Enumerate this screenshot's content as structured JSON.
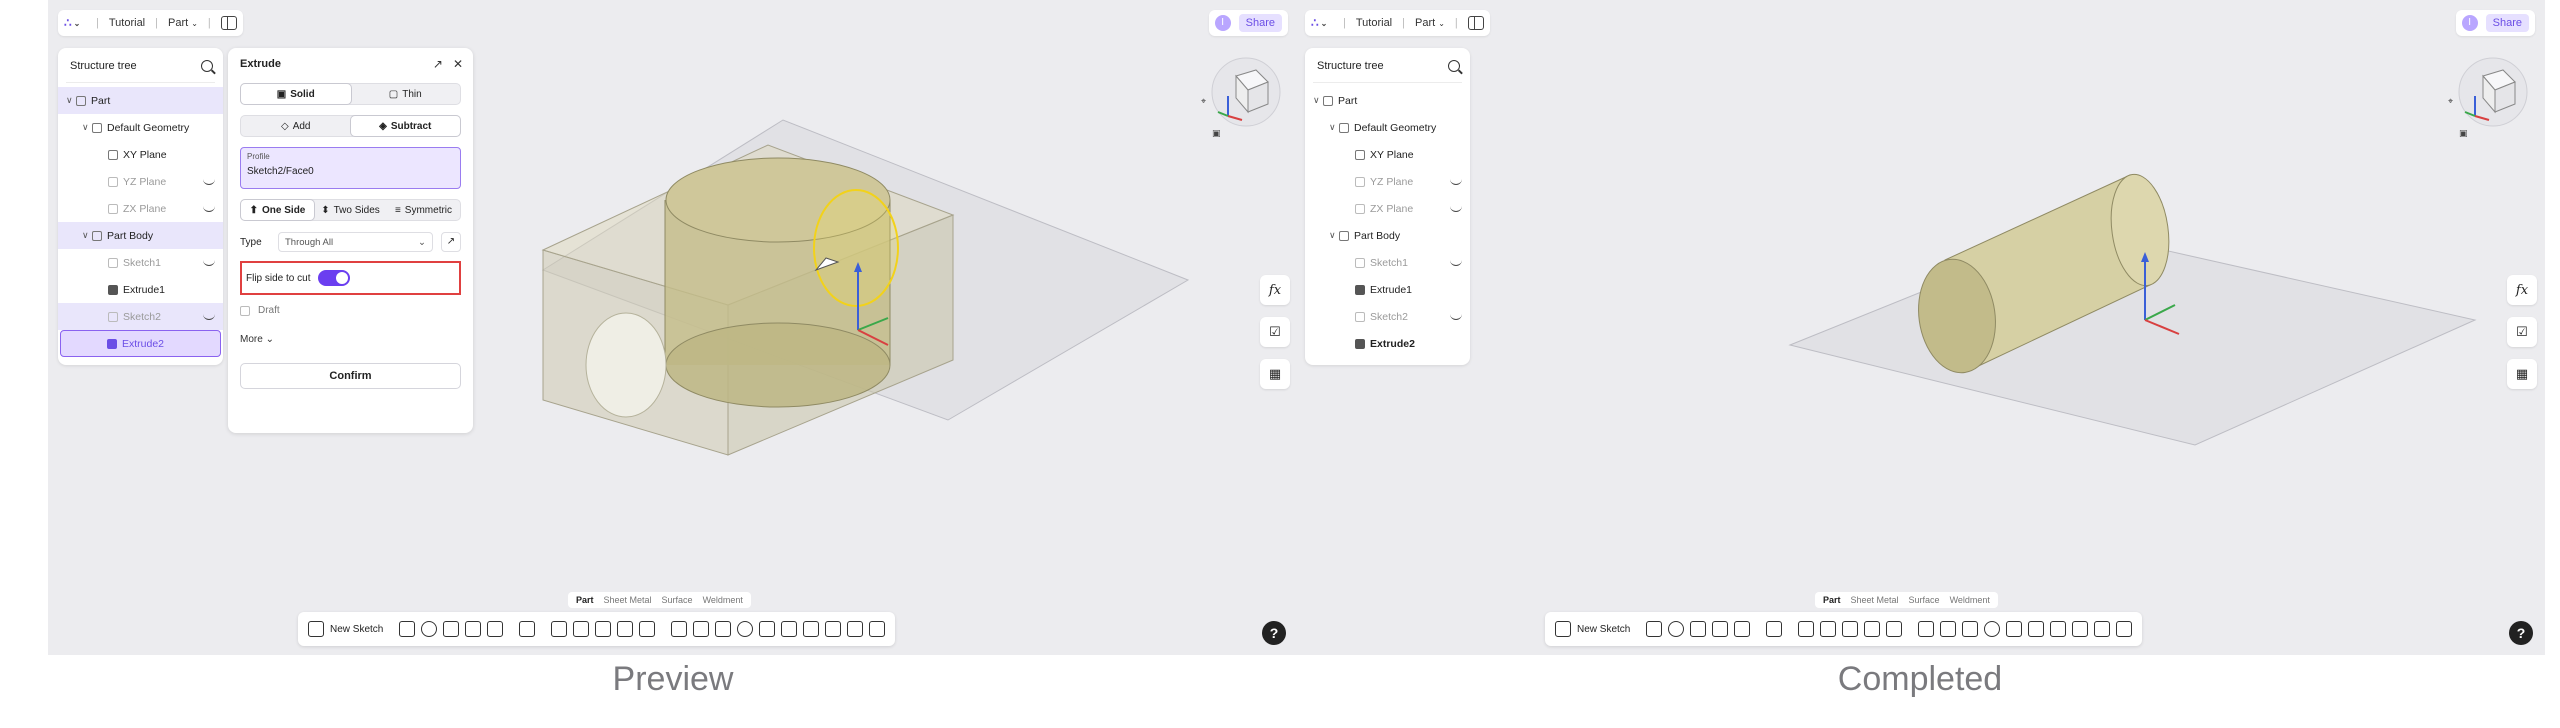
{
  "captions": {
    "left": "Preview",
    "right": "Completed"
  },
  "topbar": {
    "breadcrumb": "Tutorial",
    "doc_type": "Part",
    "share": "Share",
    "avatar_initial": "I"
  },
  "tree": {
    "title": "Structure tree",
    "items": [
      {
        "label": "Part"
      },
      {
        "label": "Default Geometry"
      },
      {
        "label": "XY Plane"
      },
      {
        "label": "YZ Plane"
      },
      {
        "label": "ZX Plane"
      },
      {
        "label": "Part Body"
      },
      {
        "label": "Sketch1"
      },
      {
        "label": "Extrude1"
      },
      {
        "label": "Sketch2"
      },
      {
        "label": "Extrude2"
      }
    ]
  },
  "extrude": {
    "title": "Extrude",
    "mode_solid": "Solid",
    "mode_thin": "Thin",
    "op_add": "Add",
    "op_subtract": "Subtract",
    "profile_label": "Profile",
    "profile_value": "Sketch2/Face0",
    "side_one": "One Side",
    "side_two": "Two Sides",
    "side_sym": "Symmetric",
    "type_label": "Type",
    "type_value": "Through All",
    "flip_label": "Flip side to cut",
    "flip_on": true,
    "draft_label": "Draft",
    "more_label": "More",
    "confirm_label": "Confirm"
  },
  "bottom_tabs": [
    "Part",
    "Sheet Metal",
    "Surface",
    "Weldment"
  ],
  "toolbar": {
    "new_sketch": "New Sketch"
  },
  "colors": {
    "accent": "#6b3ef0",
    "highlight": "#e04040",
    "solid_fill": "#d6d0a4"
  }
}
